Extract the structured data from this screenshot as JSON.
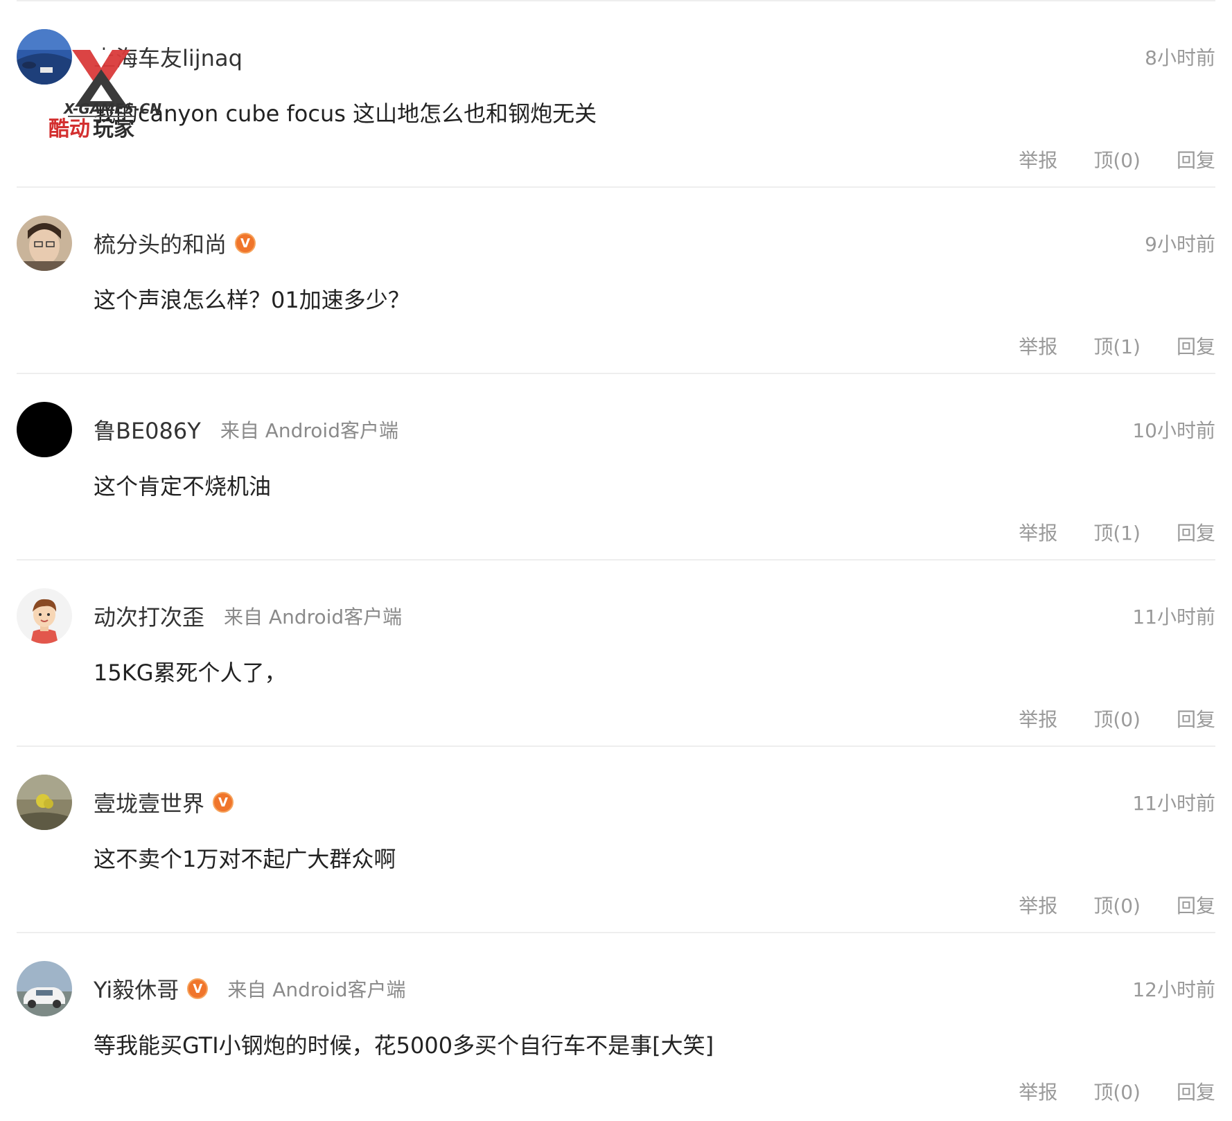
{
  "comments": [
    {
      "username": "上海车友lijnaq",
      "verified": false,
      "source": "",
      "time": "8小时前",
      "text": "我的canyon cube focus 这山地怎么也和钢炮无关",
      "report_label": "举报",
      "like_label": "顶(0)",
      "reply_label": "回复"
    },
    {
      "username": "梳分头的和尚",
      "verified": true,
      "source": "",
      "time": "9小时前",
      "text": "这个声浪怎么样？01加速多少？",
      "report_label": "举报",
      "like_label": "顶(1)",
      "reply_label": "回复"
    },
    {
      "username": "鲁BE086Y",
      "verified": false,
      "source": "来自 Android客户端",
      "time": "10小时前",
      "text": "这个肯定不烧机油",
      "report_label": "举报",
      "like_label": "顶(1)",
      "reply_label": "回复"
    },
    {
      "username": "动次打次歪",
      "verified": false,
      "source": "来自 Android客户端",
      "time": "11小时前",
      "text": "15KG累死个人了，",
      "report_label": "举报",
      "like_label": "顶(0)",
      "reply_label": "回复"
    },
    {
      "username": "壹垅壹世界",
      "verified": true,
      "source": "",
      "time": "11小时前",
      "text": "这不卖个1万对不起广大群众啊",
      "report_label": "举报",
      "like_label": "顶(0)",
      "reply_label": "回复"
    },
    {
      "username": "Yi毅休哥",
      "verified": true,
      "source": "来自 Android客户端",
      "time": "12小时前",
      "text": "等我能买GTI小钢炮的时候，花5000多买个自行车不是事[大笑]",
      "report_label": "举报",
      "like_label": "顶(0)",
      "reply_label": "回复"
    }
  ],
  "badge": {
    "letter": "V",
    "color": "#f0752b"
  },
  "watermark": {
    "line1": "X-GAMES-CN",
    "line2": "酷动玩家"
  }
}
